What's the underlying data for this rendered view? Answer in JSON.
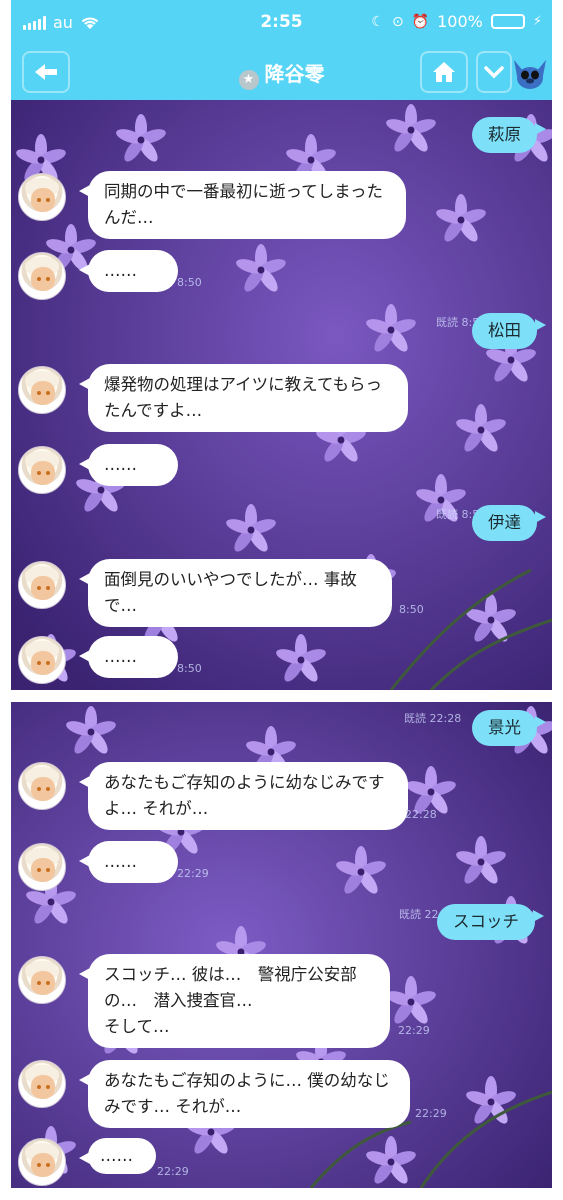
{
  "status_bar": {
    "carrier": "au",
    "time": "2:55",
    "battery": "100%",
    "battery_level": 1.0
  },
  "header": {
    "title": "降谷零"
  },
  "panel1": {
    "messages": [
      {
        "side": "right",
        "text": "萩原",
        "meta": ""
      },
      {
        "side": "left",
        "text": "同期の中で一番最初に逝ってしまったんだ…",
        "meta": ""
      },
      {
        "side": "left",
        "text": "……",
        "meta": "8:50"
      },
      {
        "side": "right",
        "text": "松田",
        "meta": "既読\n8:50"
      },
      {
        "side": "left",
        "text": "爆発物の処理はアイツに教えてもらったんですよ…",
        "meta": ""
      },
      {
        "side": "left",
        "text": "……",
        "meta": ""
      },
      {
        "side": "right",
        "text": "伊達",
        "meta": "既読\n8:50"
      },
      {
        "side": "left",
        "text": "面倒見のいいやつでしたが… 事故で…",
        "meta": "8:50"
      },
      {
        "side": "left",
        "text": "……",
        "meta": "8:50"
      }
    ]
  },
  "panel2": {
    "messages": [
      {
        "side": "right",
        "text": "景光",
        "meta": "既読\n22:28"
      },
      {
        "side": "left",
        "text": "あなたもご存知のように幼なじみですよ… それが…",
        "meta": "22:28"
      },
      {
        "side": "left",
        "text": "……",
        "meta": "22:29"
      },
      {
        "side": "right",
        "text": "スコッチ",
        "meta": "既読\n22:29"
      },
      {
        "side": "left",
        "text": "スコッチ… 彼は…　警視庁公安部の…　潜入捜査官…\nそして…",
        "meta": "22:29"
      },
      {
        "side": "left",
        "text": "あなたもご存知のように… 僕の幼なじみです… それが…",
        "meta": "22:29"
      },
      {
        "side": "left",
        "text": "……",
        "meta": "22:29"
      }
    ]
  },
  "icons": {
    "back": "back-arrow-icon",
    "home": "home-icon",
    "menu": "chevron-down-icon",
    "star": "star-badge-icon",
    "sticker": "stitch-avatar-icon"
  },
  "colors": {
    "header": "#56d4f5",
    "right_bubble": "#7ee0f8",
    "left_bubble": "#ffffff",
    "wallpaper": "#5a3a98"
  }
}
